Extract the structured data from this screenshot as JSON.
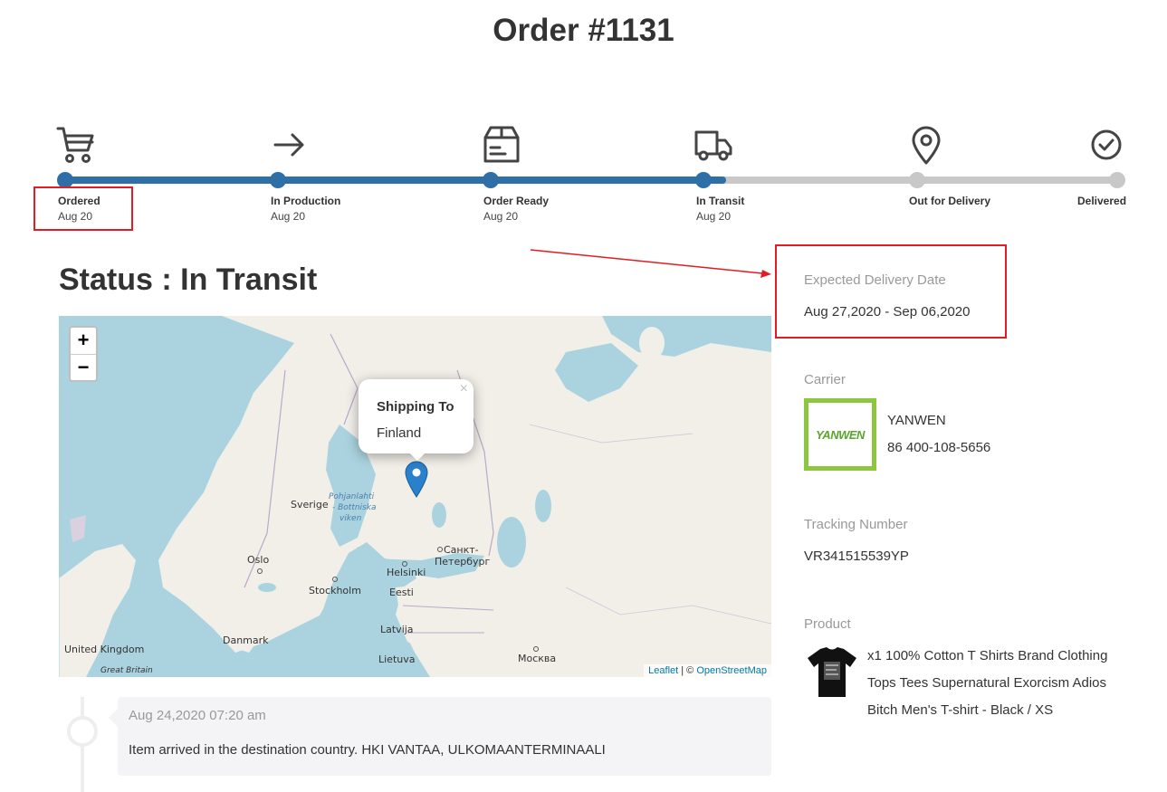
{
  "header": {
    "title": "Order #1131"
  },
  "progress": {
    "active_color": "#2e6fa8",
    "inactive_color": "#c8c8c8",
    "completed_steps": 4,
    "steps": [
      {
        "label": "Ordered",
        "date": "Aug 20",
        "icon": "cart-icon"
      },
      {
        "label": "In Production",
        "date": "Aug 20",
        "icon": "arrow-right-icon"
      },
      {
        "label": "Order Ready",
        "date": "Aug 20",
        "icon": "box-icon"
      },
      {
        "label": "In Transit",
        "date": "Aug 20",
        "icon": "truck-icon"
      },
      {
        "label": "Out for Delivery",
        "date": "",
        "icon": "map-pin-icon"
      },
      {
        "label": "Delivered",
        "date": "",
        "icon": "check-circle-icon"
      }
    ]
  },
  "status": {
    "title": "Status : In Transit"
  },
  "map": {
    "zoom_in": "+",
    "zoom_out": "−",
    "popup": {
      "title": "Shipping To",
      "value": "Finland",
      "close": "×"
    },
    "attribution": {
      "leaflet": "Leaflet",
      "separator": " | © ",
      "osm": "OpenStreetMap"
    },
    "labels": {
      "sverige": "Sverige",
      "bay1": "Pohjanlahti",
      "bay2": "- Bottniska",
      "bay3": "viken",
      "oslo": "Oslo",
      "stockholm": "Stockholm",
      "helsinki": "Helsinki",
      "spb1": "Санкт-",
      "spb2": "Петербург",
      "eesti": "Eesti",
      "latvija": "Latvija",
      "lietuva": "Lietuva",
      "moskva": "Москва",
      "danmark": "Danmark",
      "uk": "United Kingdom",
      "gb": "Great Britain"
    }
  },
  "delivery": {
    "label": "Expected Delivery Date",
    "value": "Aug 27,2020 - Sep 06,2020"
  },
  "carrier": {
    "label": "Carrier",
    "name": "YANWEN",
    "phone": "86 400-108-5656",
    "logo_text": "YANWEN",
    "logo_color": "#8dc63f"
  },
  "tracking": {
    "label": "Tracking Number",
    "value": "VR341515539YP"
  },
  "product": {
    "label": "Product",
    "description": "x1 100% Cotton T Shirts Brand Clothing Tops Tees Supernatural Exorcism Adios Bitch Men's T-shirt - Black / XS"
  },
  "event": {
    "time": "Aug 24,2020 07:20 am",
    "message": "Item arrived in the destination country. HKI VANTAA, ULKOMAANTERMINAALI"
  },
  "annotation_color": "#e31b23"
}
